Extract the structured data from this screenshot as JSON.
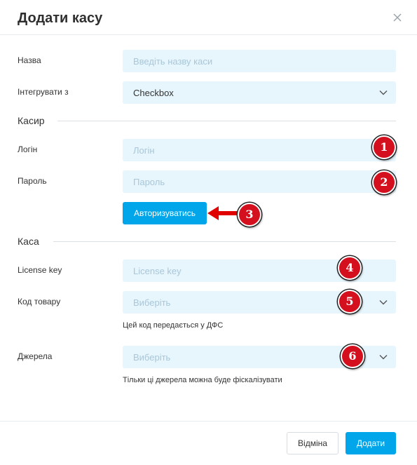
{
  "dialog": {
    "title": "Додати касу"
  },
  "form": {
    "name": {
      "label": "Назва",
      "placeholder": "Введіть назву каси"
    },
    "integrate": {
      "label": "Інтегрувати з",
      "value": "Checkbox"
    }
  },
  "cashier": {
    "section_title": "Касир",
    "login": {
      "label": "Логін",
      "placeholder": "Логін"
    },
    "password": {
      "label": "Пароль",
      "placeholder": "Пароль"
    },
    "authorize_label": "Авторизуватись"
  },
  "register": {
    "section_title": "Каса",
    "license": {
      "label": "License key",
      "placeholder": "License key"
    },
    "product_code": {
      "label": "Код товару",
      "placeholder": "Виберіть",
      "hint": "Цей код передається у ДФС"
    },
    "sources": {
      "label": "Джерела",
      "placeholder": "Виберіть",
      "hint": "Тільки ці джерела можна буде фіскалізувати"
    }
  },
  "annotations": {
    "badges": [
      "1",
      "2",
      "3",
      "4",
      "5",
      "6"
    ],
    "badge_color": "#d4101f",
    "arrow_color": "#e00000"
  },
  "footer": {
    "cancel_label": "Відміна",
    "add_label": "Додати"
  },
  "colors": {
    "accent": "#00a5ea",
    "field_bg": "#e7f5fd"
  }
}
